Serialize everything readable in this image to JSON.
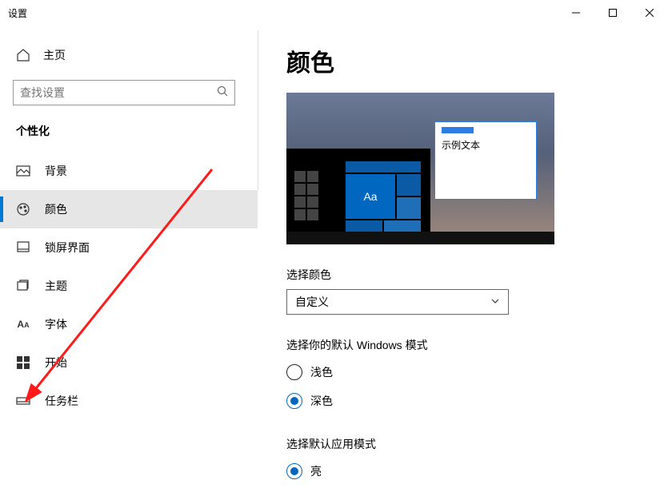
{
  "titlebar": {
    "title": "设置"
  },
  "sidebar": {
    "home": "主页",
    "search_placeholder": "查找设置",
    "section": "个性化",
    "items": [
      {
        "label": "背景"
      },
      {
        "label": "颜色"
      },
      {
        "label": "锁屏界面"
      },
      {
        "label": "主题"
      },
      {
        "label": "字体"
      },
      {
        "label": "开始"
      },
      {
        "label": "任务栏"
      }
    ]
  },
  "content": {
    "heading": "颜色",
    "sample_text": "示例文本",
    "tile_aa": "Aa",
    "choose_color_label": "选择颜色",
    "choose_color_value": "自定义",
    "windows_mode_label": "选择你的默认 Windows 模式",
    "windows_mode_options": [
      "浅色",
      "深色"
    ],
    "windows_mode_selected": 1,
    "app_mode_label": "选择默认应用模式",
    "app_mode_options": [
      "亮"
    ],
    "app_mode_selected": 0
  }
}
